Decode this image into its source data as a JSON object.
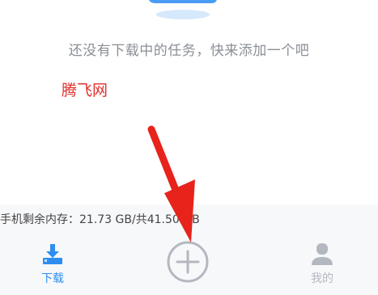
{
  "empty_state": {
    "message": "还没有下载中的任务，快来添加一个吧"
  },
  "watermark": {
    "text": "腾飞网"
  },
  "storage": {
    "text": "手机剩余内存：21.73 GB/共41.50 GB"
  },
  "bottom_nav": {
    "tabs": [
      {
        "label": "下载",
        "icon": "download-icon",
        "active": true
      },
      {
        "label": "我的",
        "icon": "user-icon",
        "active": false
      }
    ],
    "add_icon": "plus-circle-icon"
  },
  "colors": {
    "accent": "#2e8ef0",
    "inactive": "#b3b8c0",
    "arrow": "#e8231c",
    "watermark": "#e0302c"
  }
}
